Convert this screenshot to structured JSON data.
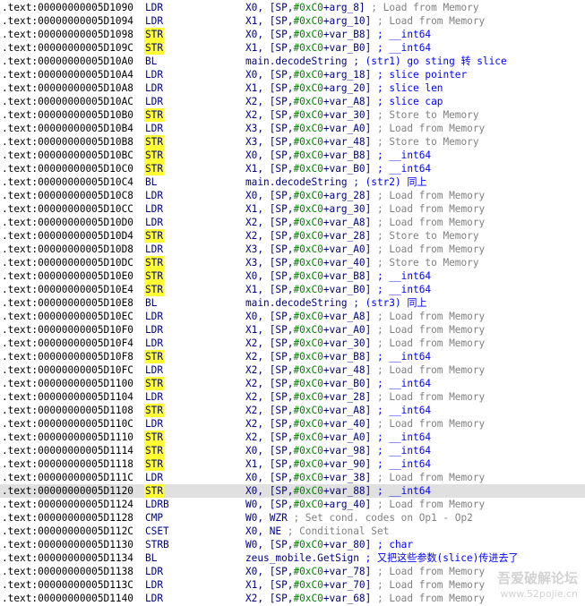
{
  "rows": [
    {
      "addr": ".text:00000000005D1090",
      "mnem": "LDR",
      "ops": "X0, [SP,#0xC0+arg_8]",
      "cmt": "; Load from Memory",
      "ctype": "gray"
    },
    {
      "addr": ".text:00000000005D1094",
      "mnem": "LDR",
      "ops": "X1, [SP,#0xC0+arg_10]",
      "cmt": "; Load from Memory",
      "ctype": "gray"
    },
    {
      "addr": ".text:00000000005D1098",
      "mnem": "STR",
      "ops": "X0, [SP,#0xC0+var_B8]",
      "cmt": "; __int64",
      "ctype": "blue",
      "hl": true
    },
    {
      "addr": ".text:00000000005D109C",
      "mnem": "STR",
      "ops": "X1, [SP,#0xC0+var_B0]",
      "cmt": "; __int64",
      "ctype": "blue",
      "hl": true
    },
    {
      "addr": ".text:00000000005D10A0",
      "mnem": "BL",
      "ops": "main.decodeString",
      "cmt": "; (str1) go sting 转 slice",
      "ctype": "blue"
    },
    {
      "addr": ".text:00000000005D10A4",
      "mnem": "LDR",
      "ops": "X0, [SP,#0xC0+arg_18]",
      "cmt": "; slice pointer",
      "ctype": "blue"
    },
    {
      "addr": ".text:00000000005D10A8",
      "mnem": "LDR",
      "ops": "X1, [SP,#0xC0+arg_20]",
      "cmt": "; slice len",
      "ctype": "blue"
    },
    {
      "addr": ".text:00000000005D10AC",
      "mnem": "LDR",
      "ops": "X2, [SP,#0xC0+var_A8]",
      "cmt": "; slice cap",
      "ctype": "blue"
    },
    {
      "addr": ".text:00000000005D10B0",
      "mnem": "STR",
      "ops": "X2, [SP,#0xC0+var_30]",
      "cmt": "; Store to Memory",
      "ctype": "gray",
      "hl": true
    },
    {
      "addr": ".text:00000000005D10B4",
      "mnem": "LDR",
      "ops": "X3, [SP,#0xC0+var_A0]",
      "cmt": "; Load from Memory",
      "ctype": "gray"
    },
    {
      "addr": ".text:00000000005D10B8",
      "mnem": "STR",
      "ops": "X3, [SP,#0xC0+var_48]",
      "cmt": "; Store to Memory",
      "ctype": "gray",
      "hl": true
    },
    {
      "addr": ".text:00000000005D10BC",
      "mnem": "STR",
      "ops": "X0, [SP,#0xC0+var_B8]",
      "cmt": "; __int64",
      "ctype": "blue",
      "hl": true
    },
    {
      "addr": ".text:00000000005D10C0",
      "mnem": "STR",
      "ops": "X1, [SP,#0xC0+var_B0]",
      "cmt": "; __int64",
      "ctype": "blue",
      "hl": true
    },
    {
      "addr": ".text:00000000005D10C4",
      "mnem": "BL",
      "ops": "main.decodeString",
      "cmt": "; (str2) 同上",
      "ctype": "blue"
    },
    {
      "addr": ".text:00000000005D10C8",
      "mnem": "LDR",
      "ops": "X0, [SP,#0xC0+arg_28]",
      "cmt": "; Load from Memory",
      "ctype": "gray"
    },
    {
      "addr": ".text:00000000005D10CC",
      "mnem": "LDR",
      "ops": "X1, [SP,#0xC0+arg_30]",
      "cmt": "; Load from Memory",
      "ctype": "gray"
    },
    {
      "addr": ".text:00000000005D10D0",
      "mnem": "LDR",
      "ops": "X2, [SP,#0xC0+var_A8]",
      "cmt": "; Load from Memory",
      "ctype": "gray"
    },
    {
      "addr": ".text:00000000005D10D4",
      "mnem": "STR",
      "ops": "X2, [SP,#0xC0+var_28]",
      "cmt": "; Store to Memory",
      "ctype": "gray",
      "hl": true
    },
    {
      "addr": ".text:00000000005D10D8",
      "mnem": "LDR",
      "ops": "X3, [SP,#0xC0+var_A0]",
      "cmt": "; Load from Memory",
      "ctype": "gray"
    },
    {
      "addr": ".text:00000000005D10DC",
      "mnem": "STR",
      "ops": "X3, [SP,#0xC0+var_40]",
      "cmt": "; Store to Memory",
      "ctype": "gray",
      "hl": true
    },
    {
      "addr": ".text:00000000005D10E0",
      "mnem": "STR",
      "ops": "X0, [SP,#0xC0+var_B8]",
      "cmt": "; __int64",
      "ctype": "blue",
      "hl": true
    },
    {
      "addr": ".text:00000000005D10E4",
      "mnem": "STR",
      "ops": "X1, [SP,#0xC0+var_B0]",
      "cmt": "; __int64",
      "ctype": "blue",
      "hl": true
    },
    {
      "addr": ".text:00000000005D10E8",
      "mnem": "BL",
      "ops": "main.decodeString",
      "cmt": "; (str3) 同上",
      "ctype": "blue"
    },
    {
      "addr": ".text:00000000005D10EC",
      "mnem": "LDR",
      "ops": "X0, [SP,#0xC0+var_A8]",
      "cmt": "; Load from Memory",
      "ctype": "gray"
    },
    {
      "addr": ".text:00000000005D10F0",
      "mnem": "LDR",
      "ops": "X1, [SP,#0xC0+var_A0]",
      "cmt": "; Load from Memory",
      "ctype": "gray"
    },
    {
      "addr": ".text:00000000005D10F4",
      "mnem": "LDR",
      "ops": "X2, [SP,#0xC0+var_30]",
      "cmt": "; Load from Memory",
      "ctype": "gray"
    },
    {
      "addr": ".text:00000000005D10F8",
      "mnem": "STR",
      "ops": "X2, [SP,#0xC0+var_B8]",
      "cmt": "; __int64",
      "ctype": "blue",
      "hl": true
    },
    {
      "addr": ".text:00000000005D10FC",
      "mnem": "LDR",
      "ops": "X2, [SP,#0xC0+var_48]",
      "cmt": "; Load from Memory",
      "ctype": "gray"
    },
    {
      "addr": ".text:00000000005D1100",
      "mnem": "STR",
      "ops": "X2, [SP,#0xC0+var_B0]",
      "cmt": "; __int64",
      "ctype": "blue",
      "hl": true
    },
    {
      "addr": ".text:00000000005D1104",
      "mnem": "LDR",
      "ops": "X2, [SP,#0xC0+var_28]",
      "cmt": "; Load from Memory",
      "ctype": "gray"
    },
    {
      "addr": ".text:00000000005D1108",
      "mnem": "STR",
      "ops": "X2, [SP,#0xC0+var_A8]",
      "cmt": "; __int64",
      "ctype": "blue",
      "hl": true
    },
    {
      "addr": ".text:00000000005D110C",
      "mnem": "LDR",
      "ops": "X2, [SP,#0xC0+var_40]",
      "cmt": "; Load from Memory",
      "ctype": "gray"
    },
    {
      "addr": ".text:00000000005D1110",
      "mnem": "STR",
      "ops": "X2, [SP,#0xC0+var_A0]",
      "cmt": "; __int64",
      "ctype": "blue",
      "hl": true
    },
    {
      "addr": ".text:00000000005D1114",
      "mnem": "STR",
      "ops": "X0, [SP,#0xC0+var_98]",
      "cmt": "; __int64",
      "ctype": "blue",
      "hl": true
    },
    {
      "addr": ".text:00000000005D1118",
      "mnem": "STR",
      "ops": "X1, [SP,#0xC0+var_90]",
      "cmt": "; __int64",
      "ctype": "blue",
      "hl": true
    },
    {
      "addr": ".text:00000000005D111C",
      "mnem": "LDR",
      "ops": "X0, [SP,#0xC0+var_38]",
      "cmt": "; Load from Memory",
      "ctype": "gray"
    },
    {
      "addr": ".text:00000000005D1120",
      "mnem": "STR",
      "ops": "X0, [SP,#0xC0+var_88]",
      "cmt": "; __int64",
      "ctype": "blue",
      "hl": true,
      "selected": true
    },
    {
      "addr": ".text:00000000005D1124",
      "mnem": "LDRB",
      "ops": "W0, [SP,#0xC0+arg_40]",
      "cmt": "; Load from Memory",
      "ctype": "gray"
    },
    {
      "addr": ".text:00000000005D1128",
      "mnem": "CMP",
      "ops": "W0, WZR",
      "cmt": "; Set cond. codes on Op1 - Op2",
      "ctype": "gray"
    },
    {
      "addr": ".text:00000000005D112C",
      "mnem": "CSET",
      "ops": "X0, NE",
      "cmt": "; Conditional Set",
      "ctype": "gray"
    },
    {
      "addr": ".text:00000000005D1130",
      "mnem": "STRB",
      "ops": "W0, [SP,#0xC0+var_80]",
      "cmt": "; char",
      "ctype": "blue"
    },
    {
      "addr": ".text:00000000005D1134",
      "mnem": "BL",
      "ops": "zeus_mobile.GetSign",
      "cmt": "; 又把这些参数(slice)传进去了",
      "ctype": "blue"
    },
    {
      "addr": ".text:00000000005D1138",
      "mnem": "LDR",
      "ops": "X0, [SP,#0xC0+var_78]",
      "cmt": "; Load from Memory",
      "ctype": "gray"
    },
    {
      "addr": ".text:00000000005D113C",
      "mnem": "LDR",
      "ops": "X1, [SP,#0xC0+var_70]",
      "cmt": "; Load from Memory",
      "ctype": "gray"
    },
    {
      "addr": ".text:00000000005D1140",
      "mnem": "LDR",
      "ops": "X2, [SP,#0xC0+var_68]",
      "cmt": "; Load from Memory",
      "ctype": "gray"
    }
  ],
  "watermark": {
    "title": "吾爱破解论坛",
    "url": "www.52pojie.cn"
  },
  "colors": {
    "highlight": "#ffff33",
    "selected_row": "#e0e0e0",
    "immediate": "#008000",
    "comment": "#808080",
    "code": "#000080"
  }
}
